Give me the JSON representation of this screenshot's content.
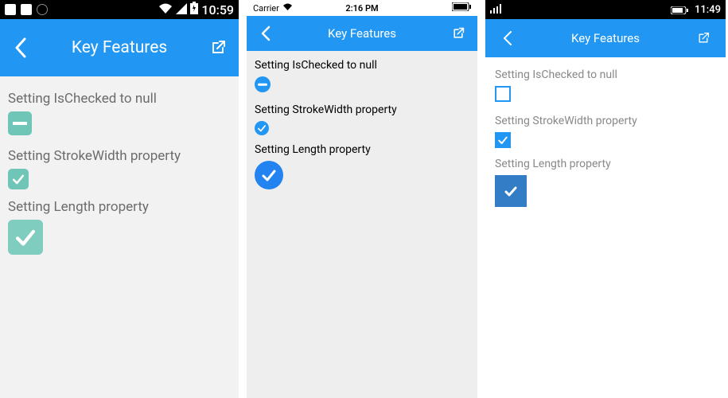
{
  "android": {
    "status": {
      "time": "10:59"
    },
    "appbar": {
      "title": "Key Features"
    },
    "items": [
      {
        "label": "Setting IsChecked to null"
      },
      {
        "label": "Setting StrokeWidth property"
      },
      {
        "label": "Setting Length property"
      }
    ]
  },
  "ios": {
    "status": {
      "carrier": "Carrier",
      "time": "2:16 PM"
    },
    "appbar": {
      "title": "Key Features"
    },
    "items": [
      {
        "label": "Setting IsChecked to null"
      },
      {
        "label": "Setting StrokeWidth property"
      },
      {
        "label": "Setting Length property"
      }
    ]
  },
  "uwp": {
    "status": {
      "time": "11:49"
    },
    "appbar": {
      "title": "Key Features"
    },
    "items": [
      {
        "label": "Setting IsChecked to null"
      },
      {
        "label": "Setting StrokeWidth property"
      },
      {
        "label": "Setting Length property"
      }
    ]
  },
  "colors": {
    "primary_blue": "#2196F3",
    "android_teal": "#6FC6B7",
    "uwp_check": "#337DC6"
  }
}
